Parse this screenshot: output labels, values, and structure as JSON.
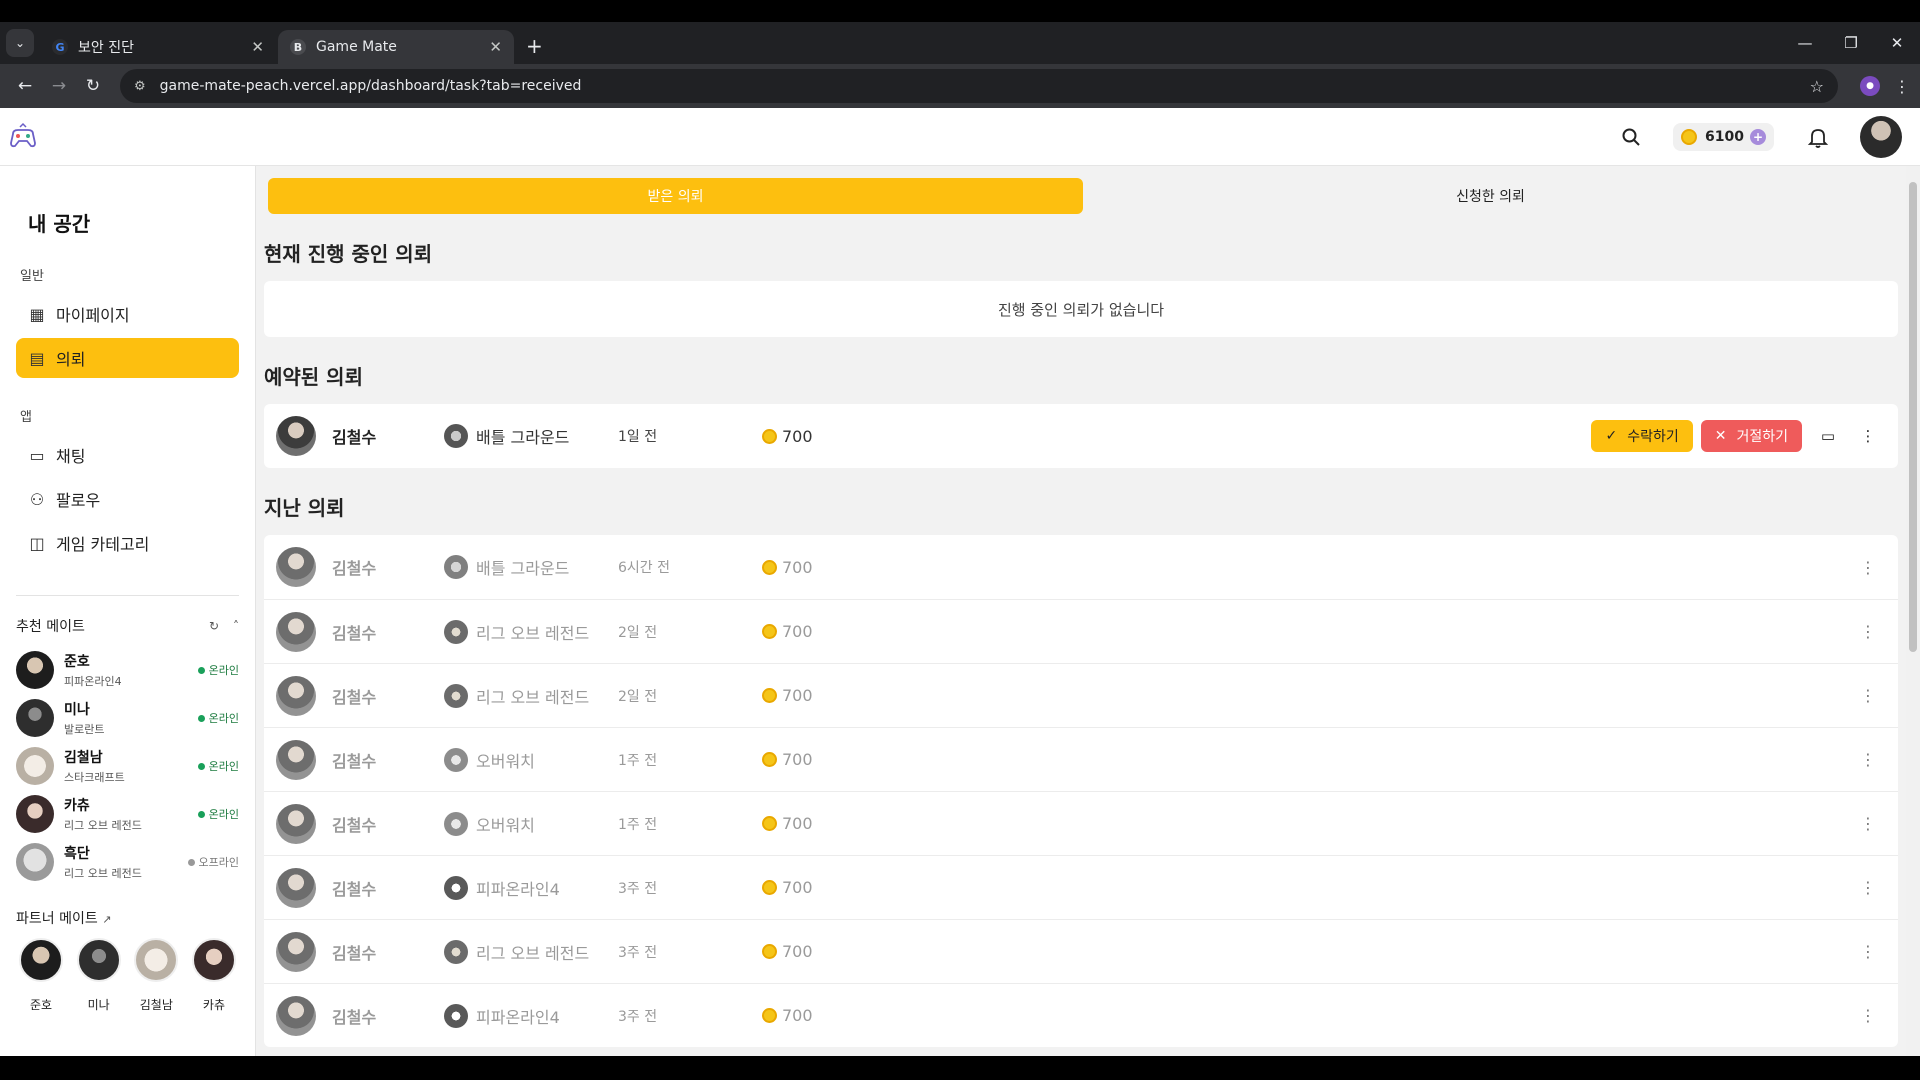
{
  "browser": {
    "tabs": [
      {
        "title": "보안 진단",
        "favicon": "google-icon",
        "active": false
      },
      {
        "title": "Game Mate",
        "favicon": "B",
        "active": true
      }
    ],
    "url": "game-mate-peach.vercel.app/dashboard/task?tab=received"
  },
  "header": {
    "coins": "6100"
  },
  "sidebar": {
    "title": "내 공간",
    "section_general": "일반",
    "section_app": "앱",
    "items_general": [
      {
        "label": "마이페이지",
        "icon": "dashboard-icon"
      },
      {
        "label": "의뢰",
        "icon": "clipboard-icon",
        "active": true
      }
    ],
    "items_app": [
      {
        "label": "채팅",
        "icon": "chat-icon"
      },
      {
        "label": "팔로우",
        "icon": "users-icon"
      },
      {
        "label": "게임 카테고리",
        "icon": "gamepad-icon"
      }
    ],
    "recommended_title": "추천 메이트",
    "recommended": [
      {
        "name": "준호",
        "game": "피파온라인4",
        "status": "온라인"
      },
      {
        "name": "미나",
        "game": "발로란트",
        "status": "온라인"
      },
      {
        "name": "김철남",
        "game": "스타크래프트",
        "status": "온라인"
      },
      {
        "name": "카츄",
        "game": "리그 오브 레전드",
        "status": "온라인"
      },
      {
        "name": "흑단",
        "game": "리그 오브 레전드",
        "status": "오프라인"
      }
    ],
    "partner_title": "파트너 메이트",
    "partners": [
      "준호",
      "미나",
      "김철남",
      "카츄"
    ]
  },
  "main": {
    "tabs": [
      "받은 의뢰",
      "신청한 의뢰"
    ],
    "current_title": "현재 진행 중인 의뢰",
    "current_empty": "진행 중인 의뢰가 없습니다",
    "reserved_title": "예약된 의뢰",
    "reserved": [
      {
        "user": "김철수",
        "game": "배틀 그라운드",
        "time": "1일 전",
        "price": "700"
      }
    ],
    "accept_label": "수락하기",
    "reject_label": "거절하기",
    "past_title": "지난 의뢰",
    "past": [
      {
        "user": "김철수",
        "game": "배틀 그라운드",
        "time": "6시간 전",
        "price": "700"
      },
      {
        "user": "김철수",
        "game": "리그 오브 레전드",
        "time": "2일 전",
        "price": "700"
      },
      {
        "user": "김철수",
        "game": "리그 오브 레전드",
        "time": "2일 전",
        "price": "700"
      },
      {
        "user": "김철수",
        "game": "오버워치",
        "time": "1주 전",
        "price": "700"
      },
      {
        "user": "김철수",
        "game": "오버워치",
        "time": "1주 전",
        "price": "700"
      },
      {
        "user": "김철수",
        "game": "피파온라인4",
        "time": "3주 전",
        "price": "700"
      },
      {
        "user": "김철수",
        "game": "리그 오브 레전드",
        "time": "3주 전",
        "price": "700"
      },
      {
        "user": "김철수",
        "game": "피파온라인4",
        "time": "3주 전",
        "price": "700"
      }
    ]
  },
  "colors": {
    "accent": "#fdbf0f",
    "reject": "#ef5b5b",
    "online": "#1aa05a"
  }
}
